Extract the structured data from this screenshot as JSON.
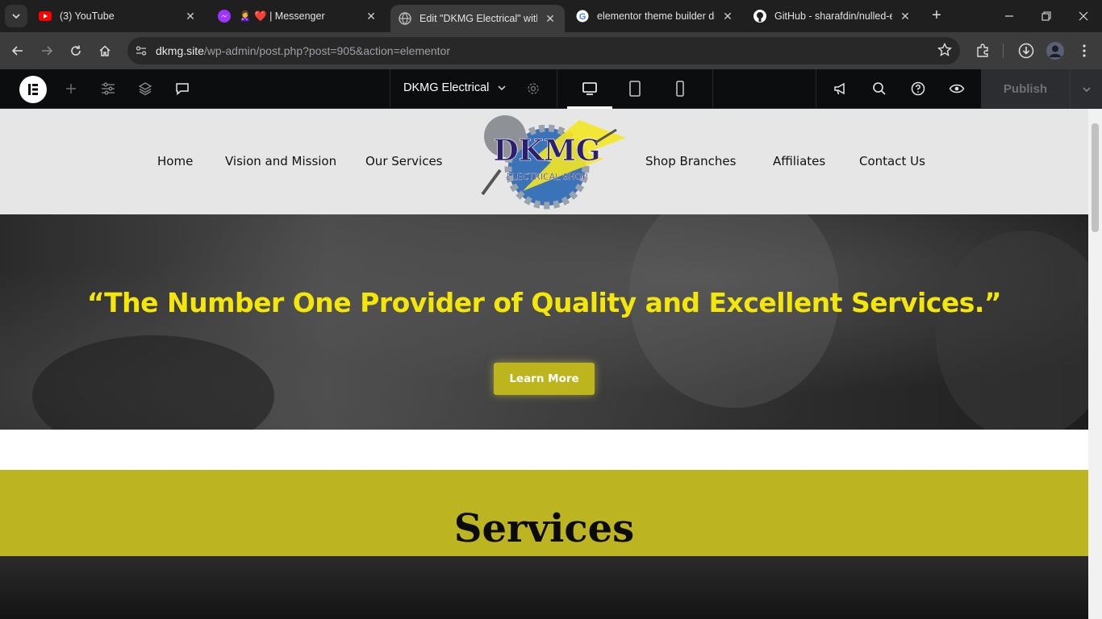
{
  "browser": {
    "tabs": [
      {
        "title": "(3) YouTube",
        "icon": "youtube-icon"
      },
      {
        "title": "🙎‍♀️ ❤️ | Messenger",
        "icon": "messenger-icon"
      },
      {
        "title": "Edit \"DKMG Electrical\" with Elementor",
        "icon": "globe-icon",
        "active": true
      },
      {
        "title": "elementor theme builder download",
        "icon": "google-icon"
      },
      {
        "title": "GitHub - sharafdin/nulled-elementor",
        "icon": "github-icon"
      }
    ],
    "address": {
      "host": "dkmg.site",
      "path": "/wp-admin/post.php?post=905&action=elementor"
    }
  },
  "elementor": {
    "document_title": "DKMG Electrical",
    "publish_label": "Publish"
  },
  "site": {
    "nav_left": [
      "Home",
      "Vision and Mission",
      "Our Services"
    ],
    "nav_right": [
      "Shop Branches",
      "Affiliates",
      "Contact Us"
    ],
    "logo": {
      "main": "DKMG",
      "sub": "ELECTRICAL SHOP"
    },
    "hero": {
      "quote": "“The Number One Provider of Quality and Excellent Services.”",
      "button_label": "Learn More"
    },
    "services_heading": "Services"
  },
  "colors": {
    "accent_yellow": "#f5e60a",
    "olive": "#bcb521",
    "header_bg": "#e6e6e6",
    "elementor_bar": "#0c0d0e"
  }
}
